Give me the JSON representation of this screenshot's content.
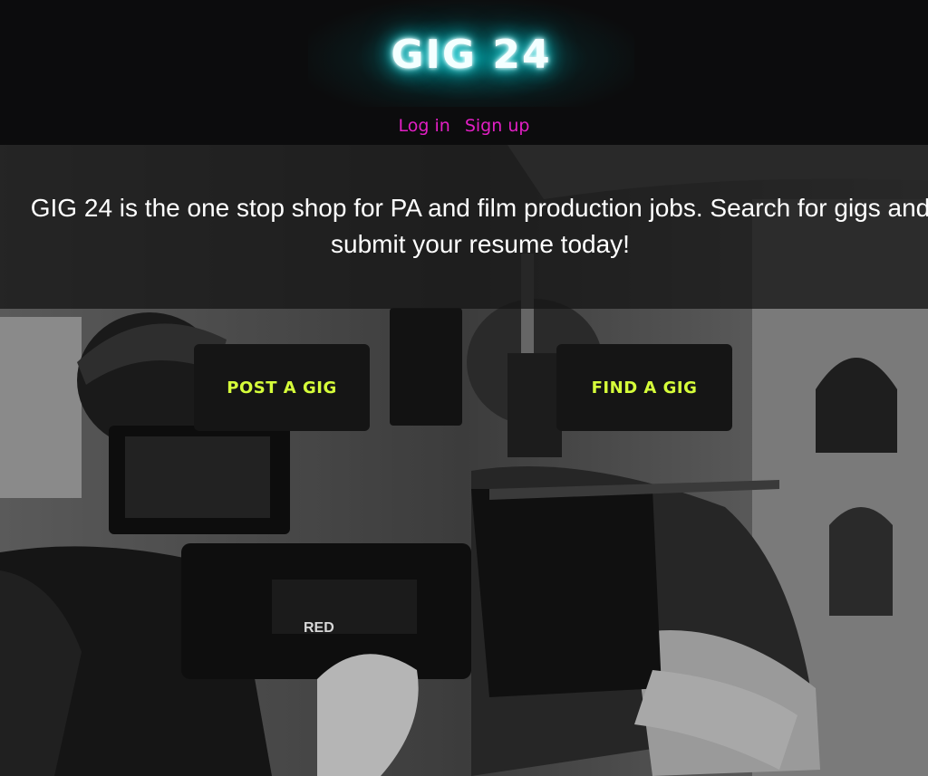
{
  "header": {
    "logo_text": "GIG 24",
    "nav": {
      "login_label": "Log in",
      "signup_label": "Sign up"
    }
  },
  "hero": {
    "tagline": "GIG 24 is the one stop shop for PA and film production jobs. Search for gigs and submit your resume today!",
    "post_button_label": "POST A GIG",
    "find_button_label": "FIND A GIG",
    "camera_brand_text": "RED"
  },
  "colors": {
    "logo_glow": "#00e6ee",
    "nav_link": "#e21fc4",
    "button_text": "#d6ff3a",
    "button_bg": "#151515",
    "header_bg": "#0c0c0d"
  }
}
